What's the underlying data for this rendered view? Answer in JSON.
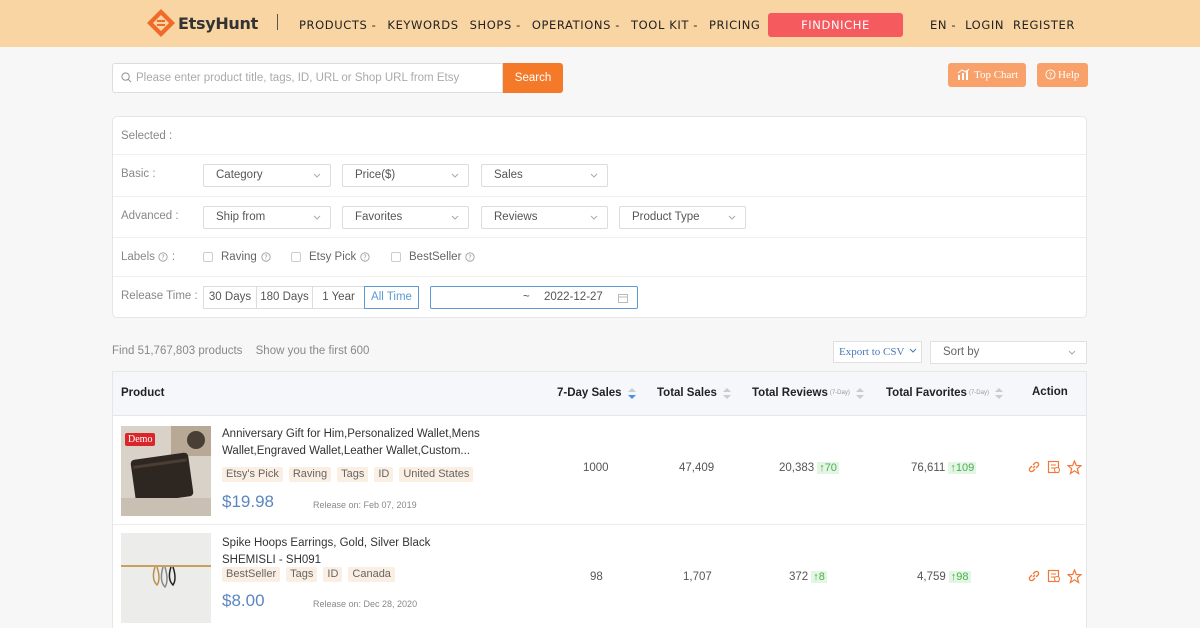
{
  "header": {
    "brand": "EtsyHunt",
    "nav": [
      "PRODUCTS -",
      "KEYWORDS",
      "SHOPS -",
      "OPERATIONS -",
      "TOOL KIT -",
      "PRICING"
    ],
    "findniche": "FINDNICHE",
    "lang": "EN -",
    "login": "LOGIN",
    "register": "REGISTER"
  },
  "search": {
    "placeholder": "Please enter product title, tags, ID, URL or Shop URL from Etsy",
    "button": "Search"
  },
  "top_chart": "Top Chart",
  "help": "Help",
  "filters": {
    "selected_label": "Selected :",
    "basic_label": "Basic :",
    "basic": [
      "Category",
      "Price($)",
      "Sales"
    ],
    "advanced_label": "Advanced :",
    "advanced": [
      "Ship from",
      "Favorites",
      "Reviews",
      "Product Type"
    ],
    "labels_label": "Labels",
    "labels": [
      "Raving",
      "Etsy Pick",
      "BestSeller"
    ],
    "release_label": "Release Time :",
    "release_options": [
      "30 Days",
      "180 Days",
      "1 Year",
      "All Time"
    ],
    "date_sep": "~",
    "date_end": "2022-12-27"
  },
  "results": {
    "found": "Find 51,767,803 products",
    "shown": "Show you the first 600",
    "export": "Export to CSV",
    "sort_placeholder": "Sort by"
  },
  "table": {
    "headers": {
      "product": "Product",
      "sales7": "7-Day Sales",
      "total_sales": "Total Sales",
      "total_reviews": "Total Reviews",
      "total_reviews_sub": "(7-Day)",
      "total_favorites": "Total Favorites",
      "total_favorites_sub": "(7-Day)",
      "action": "Action"
    },
    "rows": [
      {
        "demo": "Demo",
        "title": "Anniversary Gift for Him,Personalized Wallet,Mens Wallet,Engraved Wallet,Leather Wallet,Custom...",
        "tags": [
          "Etsy's Pick",
          "Raving",
          "Tags",
          "ID",
          "United States"
        ],
        "price": "$19.98",
        "release": "Release on: Feb 07, 2019",
        "sales7": "1000",
        "total_sales": "47,409",
        "reviews": "20,383",
        "reviews_delta": "↑70",
        "favorites": "76,611",
        "favorites_delta": "↑109"
      },
      {
        "title": "Spike Hoops Earrings, Gold, Silver Black SHEMISLI - SH091",
        "tags": [
          "BestSeller",
          "Tags",
          "ID",
          "Canada"
        ],
        "price": "$8.00",
        "release": "Release on: Dec 28, 2020",
        "sales7": "98",
        "total_sales": "1,707",
        "reviews": "372",
        "reviews_delta": "↑8",
        "favorites": "4,759",
        "favorites_delta": "↑98"
      }
    ]
  },
  "colors": {
    "topbar": "#f9d5a3",
    "accent": "#f47a2a",
    "findniche": "#f45a5e",
    "link_blue": "#5b9bd5"
  }
}
